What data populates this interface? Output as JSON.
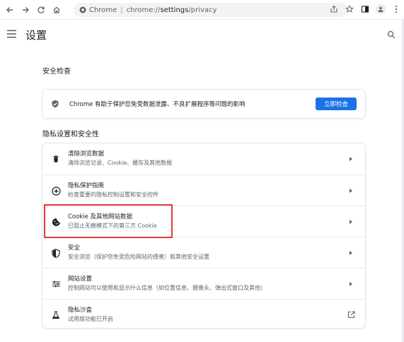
{
  "browser": {
    "site_chip": "Chrome",
    "url_scheme": "chrome://",
    "url_path_bold": "settings",
    "url_rest": "/privacy"
  },
  "header": {
    "title": "设置"
  },
  "safety_check": {
    "section_title": "安全检查",
    "description": "Chrome 有助于保护您免受数据泄露、不良扩展程序等问题的影响",
    "button_label": "立即检查"
  },
  "privacy": {
    "section_title": "隐私设置和安全性",
    "items": [
      {
        "title": "清除浏览数据",
        "subtitle": "清除浏览记录、Cookie、缓存及其他数据",
        "icon": "trash-icon",
        "action": "arrow"
      },
      {
        "title": "隐私保护指南",
        "subtitle": "检查重要的隐私控制设置和安全控件",
        "icon": "compass-icon",
        "action": "arrow"
      },
      {
        "title": "Cookie 及其他网站数据",
        "subtitle": "已阻止无痕模式下的第三方 Cookie",
        "icon": "cookie-icon",
        "action": "arrow"
      },
      {
        "title": "安全",
        "subtitle": "安全浏览（保护您免受危险网站的侵害）和其他安全设置",
        "icon": "shield-icon",
        "action": "arrow"
      },
      {
        "title": "网站设置",
        "subtitle": "控制网站可以使用和显示什么信息（如位置信息、摄像头、弹出式窗口及其他）",
        "icon": "sliders-icon",
        "action": "arrow"
      },
      {
        "title": "隐私沙盒",
        "subtitle": "试用版功能已开启",
        "icon": "flask-icon",
        "action": "external"
      }
    ]
  },
  "colors": {
    "accent": "#1a73e8",
    "highlight": "#e53935"
  }
}
